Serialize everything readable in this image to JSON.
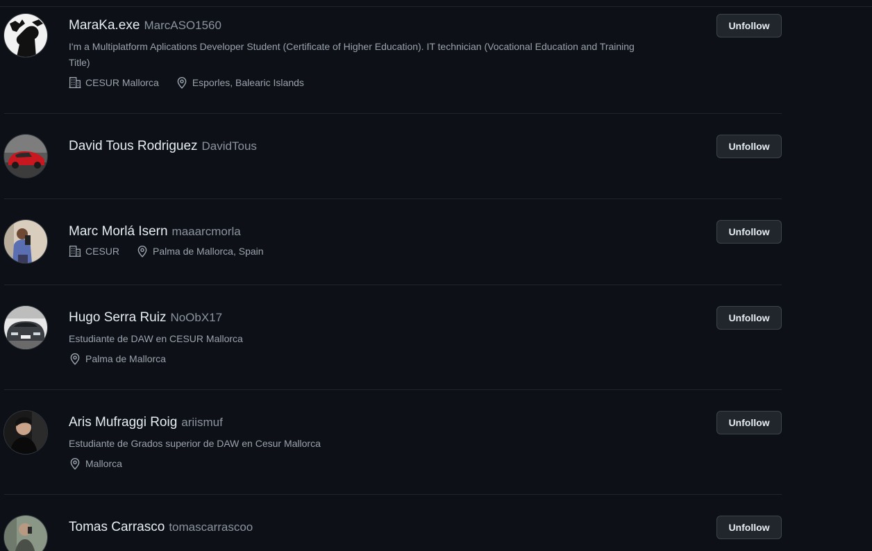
{
  "colors": {
    "background": "#0d1117",
    "divider": "#21262d",
    "text_primary": "#e6edf3",
    "text_muted": "#8b949e",
    "button_bg": "#21262d",
    "button_border": "#3d444d"
  },
  "users": [
    {
      "display_name": "MaraKa.exe",
      "handle": "MarcASO1560",
      "bio": "I'm a Multiplatform Aplications Developer Student (Certificate of Higher Education). IT technician (Vocational Education and Training Title)",
      "company": "CESUR Mallorca",
      "location": "Esporles, Balearic Islands",
      "button_label": "Unfollow",
      "avatar_icon": "silhouette-avatar"
    },
    {
      "display_name": "David Tous Rodriguez",
      "handle": "DavidTous",
      "button_label": "Unfollow",
      "avatar_icon": "red-car-avatar"
    },
    {
      "display_name": "Marc Morlá Isern",
      "handle": "maaarcmorla",
      "company": "CESUR",
      "location": "Palma de Mallorca, Spain",
      "button_label": "Unfollow",
      "avatar_icon": "person-photo-avatar"
    },
    {
      "display_name": "Hugo Serra Ruiz",
      "handle": "NoObX17",
      "bio": "Estudiante de DAW en CESUR Mallorca",
      "location": "Palma de Mallorca",
      "button_label": "Unfollow",
      "avatar_icon": "gray-car-avatar"
    },
    {
      "display_name": "Aris Mufraggi Roig",
      "handle": "ariismuf",
      "bio": "Estudiante de Grados superior de DAW en Cesur Mallorca",
      "location": "Mallorca",
      "button_label": "Unfollow",
      "avatar_icon": "person-dark-avatar"
    },
    {
      "display_name": "Tomas Carrasco",
      "handle": "tomascarrascoo",
      "button_label": "Unfollow",
      "avatar_icon": "person-photo-avatar"
    }
  ]
}
